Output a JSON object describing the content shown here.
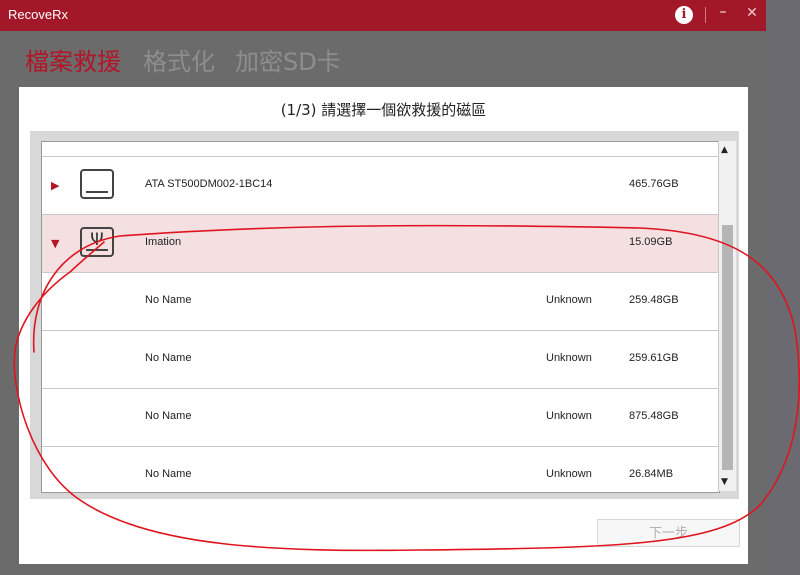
{
  "titlebar": {
    "title": "RecoveRx",
    "info_glyph": "i",
    "minimize_glyph": "–",
    "close_glyph": "✕"
  },
  "tabs": [
    {
      "label": "檔案救援",
      "active": true
    },
    {
      "label": "格式化",
      "active": false
    },
    {
      "label": "加密SD卡",
      "active": false
    }
  ],
  "panel": {
    "heading": "(1/3) 請選擇一個欲救援的磁區"
  },
  "drives": [
    {
      "name": "ATA ST500DM002-1BC14",
      "size": "465.76GB",
      "icon": "hard-drive-icon",
      "expanded": false
    },
    {
      "name": "Imation",
      "size": "15.09GB",
      "icon": "usb-drive-icon",
      "expanded": true,
      "selected": true
    }
  ],
  "partitions": [
    {
      "name": "No Name",
      "fs": "Unknown",
      "size": "259.48GB"
    },
    {
      "name": "No Name",
      "fs": "Unknown",
      "size": "259.61GB"
    },
    {
      "name": "No Name",
      "fs": "Unknown",
      "size": "875.48GB"
    },
    {
      "name": "No Name",
      "fs": "Unknown",
      "size": "26.84MB"
    }
  ],
  "buttons": {
    "next": "下一步"
  },
  "colors": {
    "accent": "#a31829",
    "selected_row": "#f4dfe1",
    "annotation": "#e0141e"
  }
}
